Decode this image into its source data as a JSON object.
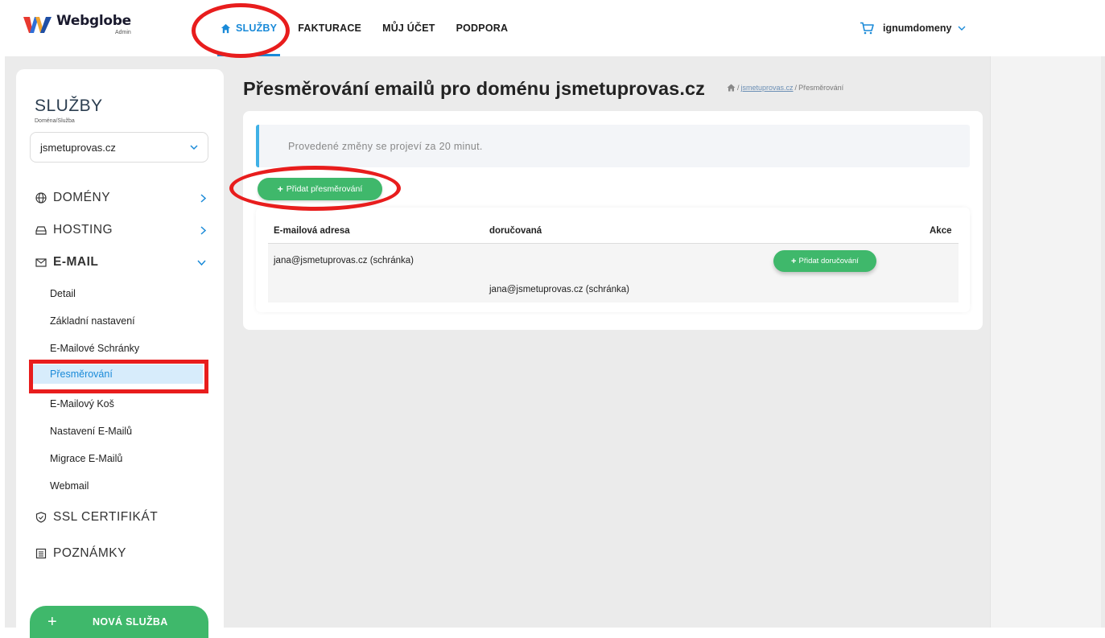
{
  "brand": {
    "name": "Webglobe",
    "sub": "Admin"
  },
  "nav": {
    "items": [
      {
        "label": "SLUŽBY",
        "active": true
      },
      {
        "label": "FAKTURACE",
        "active": false
      },
      {
        "label": "MŮJ ÚČET",
        "active": false
      },
      {
        "label": "PODPORA",
        "active": false
      }
    ],
    "user": "ignumdomeny"
  },
  "sidebar": {
    "title": "SLUŽBY",
    "subtitle": "Doména/Služba",
    "selected_domain": "jsmetuprovas.cz",
    "menu": [
      {
        "label": "DOMÉNY",
        "icon": "globe-icon"
      },
      {
        "label": "HOSTING",
        "icon": "server-icon"
      },
      {
        "label": "E-MAIL",
        "icon": "mail-icon"
      },
      {
        "label": "SSL CERTIFIKÁT",
        "icon": "shield-icon"
      },
      {
        "label": "POZNÁMKY",
        "icon": "notes-icon"
      }
    ],
    "email_sub": [
      "Detail",
      "Základní nastavení",
      "E-Mailové Schránky",
      "Přesměrování",
      "E-Mailový Koš",
      "Nastavení E-Mailů",
      "Migrace E-Mailů",
      "Webmail"
    ],
    "new_service": "NOVÁ SLUŽBA"
  },
  "main": {
    "title": "Přesměrování emailů pro doménu jsmetuprovas.cz",
    "breadcrumb": {
      "sep": "/",
      "link": "jsmetuprovas.cz",
      "current": "Přesměrování"
    },
    "notice": "Provedené změny se projeví za 20 minut.",
    "add_redirect": "Přidat přesměrování",
    "table": {
      "headers": [
        "E-mailová adresa",
        "doručovaná",
        "Akce"
      ],
      "row": {
        "address": "jana@jsmetuprovas.cz (schránka)",
        "delivered": "jana@jsmetuprovas.cz (schránka)",
        "action": "Přidat doručování"
      }
    }
  },
  "colors": {
    "accent": "#1a8ad8",
    "green": "#3fb86b",
    "annotation": "#e81d1d"
  }
}
